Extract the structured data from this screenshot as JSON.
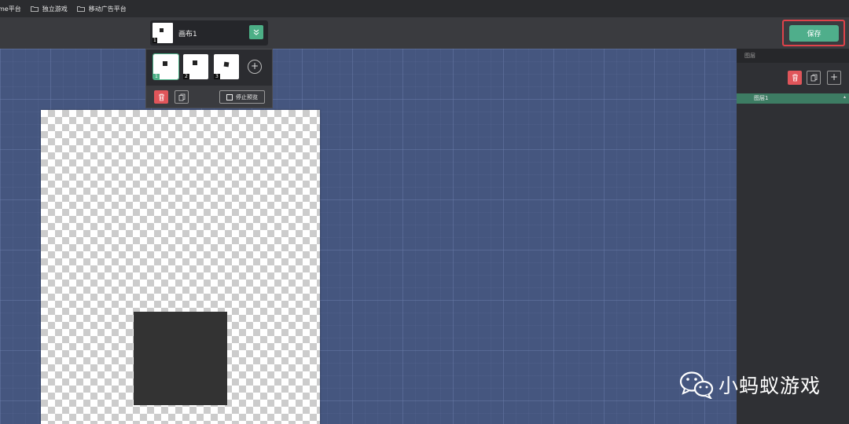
{
  "bookmarks": [
    {
      "label": "me平台",
      "icon": "folder-icon"
    },
    {
      "label": "独立游戏",
      "icon": "folder-icon"
    },
    {
      "label": "移动广告平台",
      "icon": "folder-icon"
    }
  ],
  "toolbar": {
    "canvas_name": "画布1",
    "canvas_number": "1",
    "save_label": "保存"
  },
  "frames": {
    "items": [
      {
        "number": "1",
        "active": true
      },
      {
        "number": "2",
        "active": false
      },
      {
        "number": "3",
        "active": false
      }
    ],
    "add_label": "+",
    "stop_preview_label": "停止预览"
  },
  "layers": {
    "header": "图层",
    "add_label": "+",
    "items": [
      {
        "label": "图层1",
        "selected": true
      }
    ]
  },
  "colors": {
    "accent": "#4fae8b",
    "danger": "#e0555a",
    "workspace": "#45567f",
    "highlight_border": "#e0424a"
  },
  "watermark": {
    "text": "小蚂蚁游戏",
    "icon": "wechat-icon"
  }
}
